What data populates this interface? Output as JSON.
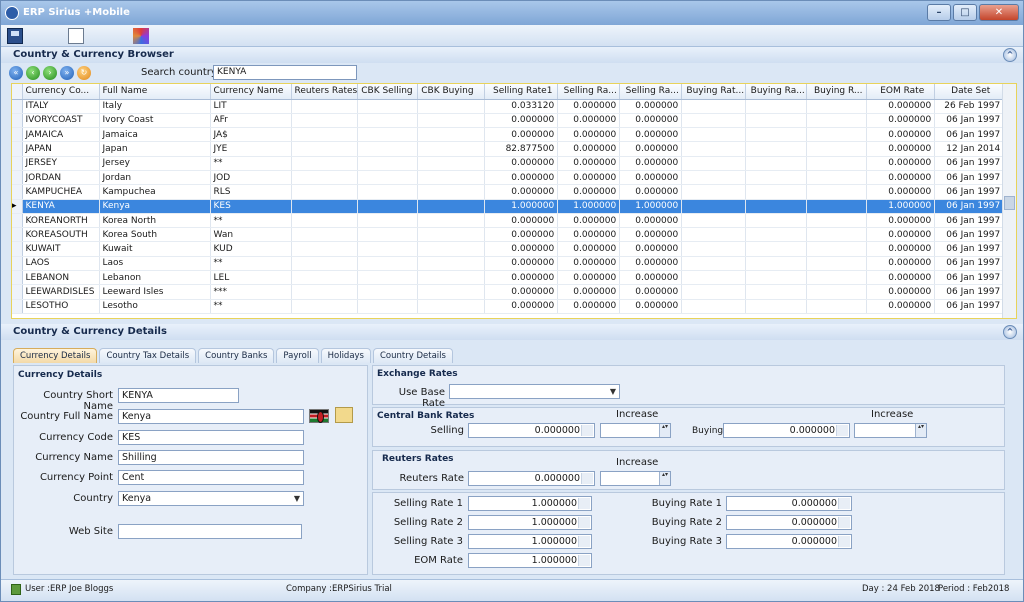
{
  "window": {
    "title": "ERP Sirius +Mobile",
    "minimize": "–",
    "maximize": "□",
    "close": "✕"
  },
  "browser": {
    "title": "Country & Currency Browser",
    "search_label": "Search country",
    "search_value": "KENYA"
  },
  "grid": {
    "columns": [
      "Currency Co...",
      "Full Name",
      "Currency Name",
      "Reuters Rates",
      "CBK Selling",
      "CBK Buying",
      "Selling Rate1",
      "Selling Ra...",
      "Selling Ra...",
      "Buying Rat...",
      "Buying Ra...",
      "Buying R...",
      "EOM Rate",
      "Date Set"
    ],
    "rows": [
      [
        "ITALY",
        "Italy",
        "LIT",
        "",
        "",
        "",
        "0.033120",
        "0.000000",
        "0.000000",
        "",
        "",
        "",
        "0.000000",
        "26 Feb 1997"
      ],
      [
        "IVORYCOAST",
        "Ivory Coast",
        "AFr",
        "",
        "",
        "",
        "0.000000",
        "0.000000",
        "0.000000",
        "",
        "",
        "",
        "0.000000",
        "06 Jan 1997"
      ],
      [
        "JAMAICA",
        "Jamaica",
        "JA$",
        "",
        "",
        "",
        "0.000000",
        "0.000000",
        "0.000000",
        "",
        "",
        "",
        "0.000000",
        "06 Jan 1997"
      ],
      [
        "JAPAN",
        "Japan",
        "JYE",
        "",
        "",
        "",
        "82.877500",
        "0.000000",
        "0.000000",
        "",
        "",
        "",
        "0.000000",
        "12 Jan 2014"
      ],
      [
        "JERSEY",
        "Jersey",
        "**",
        "",
        "",
        "",
        "0.000000",
        "0.000000",
        "0.000000",
        "",
        "",
        "",
        "0.000000",
        "06 Jan 1997"
      ],
      [
        "JORDAN",
        "Jordan",
        "JOD",
        "",
        "",
        "",
        "0.000000",
        "0.000000",
        "0.000000",
        "",
        "",
        "",
        "0.000000",
        "06 Jan 1997"
      ],
      [
        "KAMPUCHEA",
        "Kampuchea",
        "RLS",
        "",
        "",
        "",
        "0.000000",
        "0.000000",
        "0.000000",
        "",
        "",
        "",
        "0.000000",
        "06 Jan 1997"
      ],
      [
        "KENYA",
        "Kenya",
        "KES",
        "",
        "",
        "",
        "1.000000",
        "1.000000",
        "1.000000",
        "",
        "",
        "",
        "1.000000",
        "06 Jan 1997"
      ],
      [
        "KOREANORTH",
        "Korea North",
        "**",
        "",
        "",
        "",
        "0.000000",
        "0.000000",
        "0.000000",
        "",
        "",
        "",
        "0.000000",
        "06 Jan 1997"
      ],
      [
        "KOREASOUTH",
        "Korea South",
        "Wan",
        "",
        "",
        "",
        "0.000000",
        "0.000000",
        "0.000000",
        "",
        "",
        "",
        "0.000000",
        "06 Jan 1997"
      ],
      [
        "KUWAIT",
        "Kuwait",
        "KUD",
        "",
        "",
        "",
        "0.000000",
        "0.000000",
        "0.000000",
        "",
        "",
        "",
        "0.000000",
        "06 Jan 1997"
      ],
      [
        "LAOS",
        "Laos",
        "**",
        "",
        "",
        "",
        "0.000000",
        "0.000000",
        "0.000000",
        "",
        "",
        "",
        "0.000000",
        "06 Jan 1997"
      ],
      [
        "LEBANON",
        "Lebanon",
        "LEL",
        "",
        "",
        "",
        "0.000000",
        "0.000000",
        "0.000000",
        "",
        "",
        "",
        "0.000000",
        "06 Jan 1997"
      ],
      [
        "LEEWARDISLES",
        "Leeward Isles",
        "***",
        "",
        "",
        "",
        "0.000000",
        "0.000000",
        "0.000000",
        "",
        "",
        "",
        "0.000000",
        "06 Jan 1997"
      ],
      [
        "LESOTHO",
        "Lesotho",
        "**",
        "",
        "",
        "",
        "0.000000",
        "0.000000",
        "0.000000",
        "",
        "",
        "",
        "0.000000",
        "06 Jan 1997"
      ]
    ],
    "selected_row": 7
  },
  "details": {
    "title": "Country & Currency Details",
    "tabs": [
      "Currency Details",
      "Country Tax Details",
      "Country Banks",
      "Payroll",
      "Holidays",
      "Country Details"
    ],
    "active_tab": 0,
    "currency": {
      "title": "Currency Details",
      "short_name_label": "Country Short Name",
      "short_name": "KENYA",
      "full_name_label": "Country Full Name",
      "full_name": "Kenya",
      "code_label": "Currency Code",
      "code": "KES",
      "name_label": "Currency Name",
      "name": "Shilling",
      "point_label": "Currency Point",
      "point": "Cent",
      "country_label": "Country",
      "country": "Kenya",
      "website_label": "Web Site",
      "website": ""
    },
    "exchange": {
      "title": "Exchange Rates",
      "base_label": "Use Base Rate",
      "base_value": ""
    },
    "central": {
      "title": "Central Bank Rates",
      "increase1": "Increase",
      "increase2": "Increase",
      "selling_label": "Selling",
      "selling": "0.000000",
      "buying_label": "Buying",
      "buying": "0.000000"
    },
    "reuters": {
      "title": "Reuters Rates",
      "increase": "Increase",
      "rate_label": "Reuters Rate",
      "rate": "0.000000"
    },
    "rates": {
      "sr1_label": "Selling Rate 1",
      "sr1": "1.000000",
      "sr2_label": "Selling Rate 2",
      "sr2": "1.000000",
      "sr3_label": "Selling Rate 3",
      "sr3": "1.000000",
      "eom_label": "EOM Rate",
      "eom": "1.000000",
      "br1_label": "Buying Rate 1",
      "br1": "0.000000",
      "br2_label": "Buying Rate 2",
      "br2": "0.000000",
      "br3_label": "Buying Rate 3",
      "br3": "0.000000"
    }
  },
  "status": {
    "user": "User :ERP Joe Bloggs",
    "company": "Company :ERPSirius Trial",
    "day": "Day : 24 Feb 2018",
    "period": "Period : Feb2018"
  }
}
